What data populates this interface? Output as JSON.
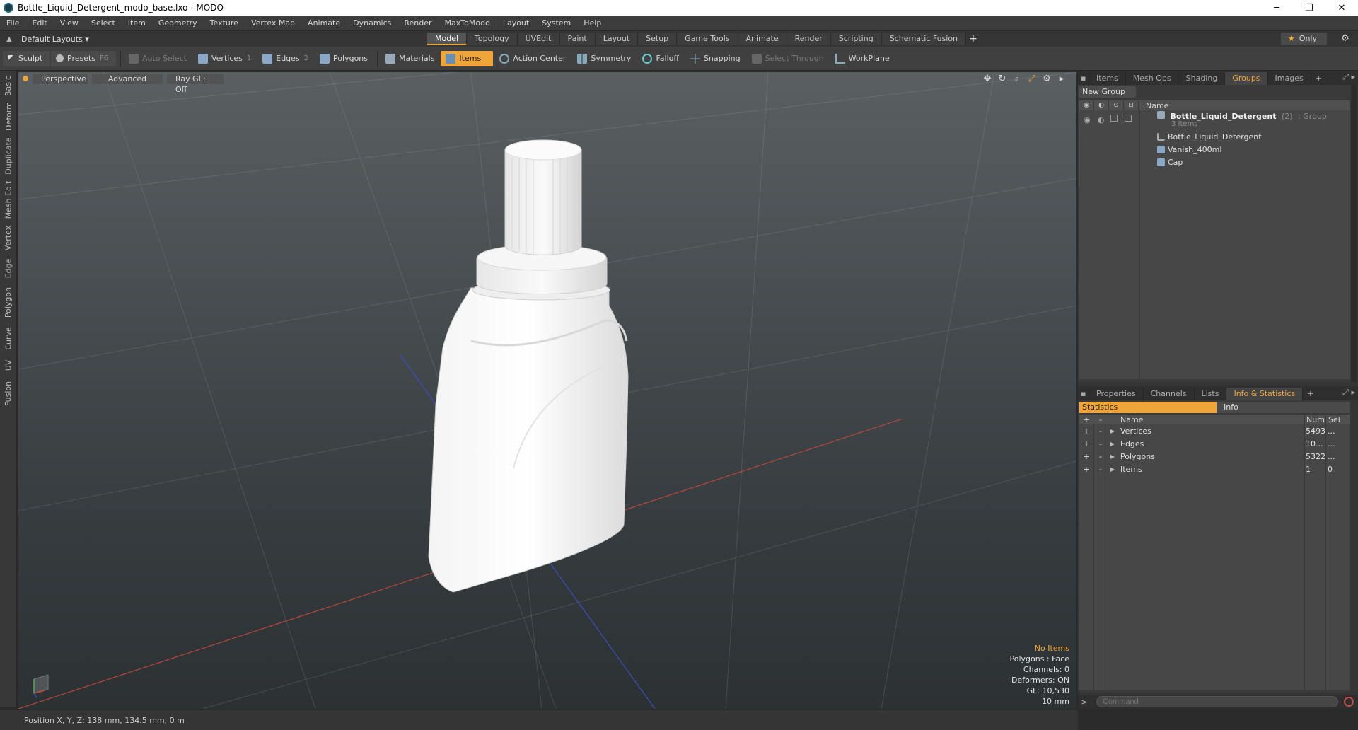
{
  "window": {
    "title": "Bottle_Liquid_Detergent_modo_base.lxo - MODO",
    "minimize": "─",
    "maximize": "❐",
    "close": "✕"
  },
  "menu": [
    "File",
    "Edit",
    "View",
    "Select",
    "Item",
    "Geometry",
    "Texture",
    "Vertex Map",
    "Animate",
    "Dynamics",
    "Render",
    "MaxToModo",
    "Layout",
    "System",
    "Help"
  ],
  "layoutbar": {
    "layouts_label": "Default Layouts ▾",
    "tabs": [
      "Model",
      "Topology",
      "UVEdit",
      "Paint",
      "Layout",
      "Setup",
      "Game Tools",
      "Animate",
      "Render",
      "Scripting",
      "Schematic Fusion"
    ],
    "active_tab": "Model",
    "add_tab": "+",
    "only_label": "Only"
  },
  "toolbar": {
    "sculpt": "Sculpt",
    "presets": "Presets",
    "presets_key": "F6",
    "auto_select": "Auto Select",
    "vertices": "Vertices",
    "vertices_key": "1",
    "edges": "Edges",
    "edges_key": "2",
    "polygons": "Polygons",
    "materials": "Materials",
    "items": "Items",
    "action_center": "Action Center",
    "symmetry": "Symmetry",
    "falloff": "Falloff",
    "snapping": "Snapping",
    "select_through": "Select Through",
    "workplane": "WorkPlane"
  },
  "left_tabs": [
    "Basic",
    "Deform",
    "Duplicate",
    "Mesh Edit",
    "Vertex",
    "Edge",
    "Polygon",
    "Curve",
    "UV",
    "Fusion"
  ],
  "viewport": {
    "view_mode": "Perspective",
    "shading": "Advanced",
    "raygl": "Ray GL: Off",
    "info": {
      "selection": "No Items",
      "polygons": "Polygons : Face",
      "channels": "Channels: 0",
      "deformers": "Deformers: ON",
      "gl": "GL: 10,530",
      "scale": "10 mm"
    }
  },
  "groups_panel": {
    "tabs": [
      "Items",
      "Mesh Ops",
      "Shading",
      "Groups",
      "Images"
    ],
    "active_tab": "Groups",
    "new_group": "New Group",
    "name_header": "Name",
    "group": {
      "name": "Bottle_Liquid_Detergent",
      "count": "(2)",
      "type": ": Group",
      "items_count": "3 Items"
    },
    "children": [
      "Bottle_Liquid_Detergent",
      "Vanish_400ml",
      "Cap"
    ]
  },
  "info_panel": {
    "tabs": [
      "Properties",
      "Channels",
      "Lists",
      "Info & Statistics"
    ],
    "active_tab": "Info & Statistics",
    "subtab_statistics": "Statistics",
    "subtab_info": "Info",
    "columns": {
      "name": "Name",
      "num": "Num",
      "sel": "Sel"
    },
    "rows": [
      {
        "name": "Vertices",
        "num": "5493",
        "sel": "..."
      },
      {
        "name": "Edges",
        "num": "10...",
        "sel": "..."
      },
      {
        "name": "Polygons",
        "num": "5322",
        "sel": "..."
      },
      {
        "name": "Items",
        "num": "1",
        "sel": "0"
      }
    ]
  },
  "command": {
    "placeholder": "Command",
    "prompt": ">"
  },
  "status": {
    "position": "Position X, Y, Z:   138 mm, 134.5 mm, 0 m"
  },
  "colors": {
    "accent": "#f0a53a",
    "x_axis": "#c0463c",
    "z_axis": "#4050c8"
  }
}
